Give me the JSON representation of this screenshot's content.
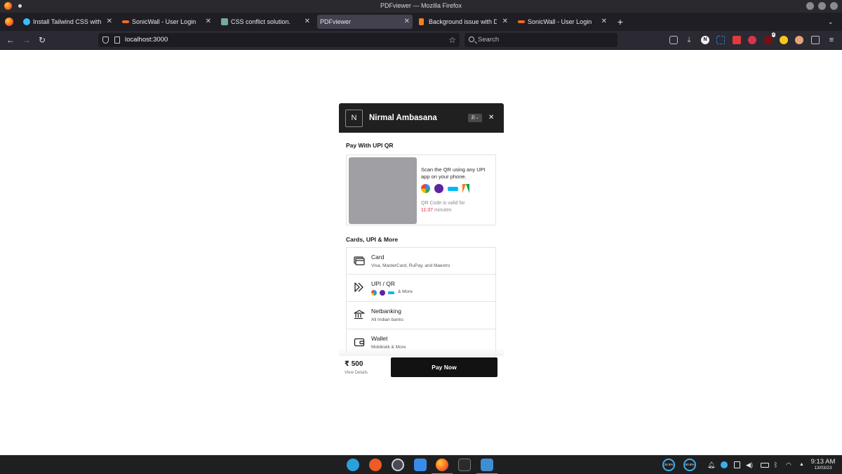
{
  "window": {
    "title": "PDFviewer — Mozilla Firefox"
  },
  "tabs": [
    {
      "label": "Install Tailwind CSS with Ne",
      "icon": "tailwind-icon",
      "color": "#38bdf8"
    },
    {
      "label": "SonicWall - User Login",
      "icon": "sonicwall-icon",
      "color": "#f26a21"
    },
    {
      "label": "CSS conflict solution.",
      "icon": "chatgpt-icon",
      "color": "#74aa9c"
    },
    {
      "label": "PDFviewer",
      "icon": "",
      "color": ""
    },
    {
      "label": "Background issue with Dai",
      "icon": "stackoverflow-icon",
      "color": "#f48024"
    },
    {
      "label": "SonicWall - User Login",
      "icon": "sonicwall-icon",
      "color": "#f26a21"
    }
  ],
  "navbar": {
    "url": "localhost:3000",
    "search_placeholder": "Search"
  },
  "extensions": [
    {
      "name": "pocket-icon",
      "color": "#bfbfc4"
    },
    {
      "name": "downloads-icon",
      "color": "#bfbfc4"
    },
    {
      "name": "n-extension-icon",
      "color": "#f0f0f4",
      "letter": "N"
    },
    {
      "name": "grid-extension-icon",
      "color": "#2f7fe0"
    },
    {
      "name": "color-picker-icon",
      "color": "#e03a3a"
    },
    {
      "name": "plane-extension-icon",
      "color": "#d6344d"
    },
    {
      "name": "ublock-icon",
      "color": "#7a0d0d",
      "badge": "2"
    },
    {
      "name": "sun-extension-icon",
      "color": "#f5c61b"
    },
    {
      "name": "face-extension-icon",
      "color": "#e7a37b"
    },
    {
      "name": "puzzle-icon",
      "color": "#bfbfc4"
    }
  ],
  "checkout": {
    "merchant_initial": "N",
    "merchant_name": "Nirmal Ambasana",
    "lang_button": "あ⌄",
    "close": "✕",
    "upi_qr": {
      "title": "Pay With UPI QR",
      "instruction": "Scan the QR using any UPI app on your phone.",
      "apps": [
        {
          "name": "gpay-icon",
          "color": "#4285f4"
        },
        {
          "name": "phonepe-icon",
          "color": "#5f259f"
        },
        {
          "name": "paytm-icon",
          "color": "#00baf2"
        },
        {
          "name": "bhim-icon",
          "color": "#f47920"
        }
      ],
      "valid_text": "QR Code is valid for",
      "timer": "11:37",
      "timer_unit": "minutes"
    },
    "methods_title": "Cards, UPI & More",
    "methods": [
      {
        "icon": "card-icon",
        "title": "Card",
        "subtitle": "Visa, MasterCard, RuPay, and Maestro"
      },
      {
        "icon": "upi-icon",
        "title": "UPI / QR",
        "subtitle": "& More"
      },
      {
        "icon": "bank-icon",
        "title": "Netbanking",
        "subtitle": "All Indian banks"
      },
      {
        "icon": "wallet-icon",
        "title": "Wallet",
        "subtitle": "Mobikwik & More"
      }
    ],
    "footer": {
      "amount": "₹ 500",
      "view_details": "View Details",
      "pay_button": "Pay Now"
    }
  },
  "taskbar": {
    "apps": [
      {
        "name": "telegram-icon",
        "color": "#2aa1da"
      },
      {
        "name": "postman-icon",
        "color": "#ef5b25"
      },
      {
        "name": "obs-icon",
        "color": "#4a4a55"
      },
      {
        "name": "finder-icon",
        "color": "#3a8be8"
      },
      {
        "name": "firefox-icon",
        "color": "#ff7139"
      },
      {
        "name": "terminal-icon",
        "color": "#2b2b2b"
      },
      {
        "name": "vscode-icon",
        "color": "#3e8ed0"
      }
    ],
    "cpu": "34.5%",
    "mem": "60.8%",
    "time": "9:13 AM",
    "date": "13/03/23"
  }
}
